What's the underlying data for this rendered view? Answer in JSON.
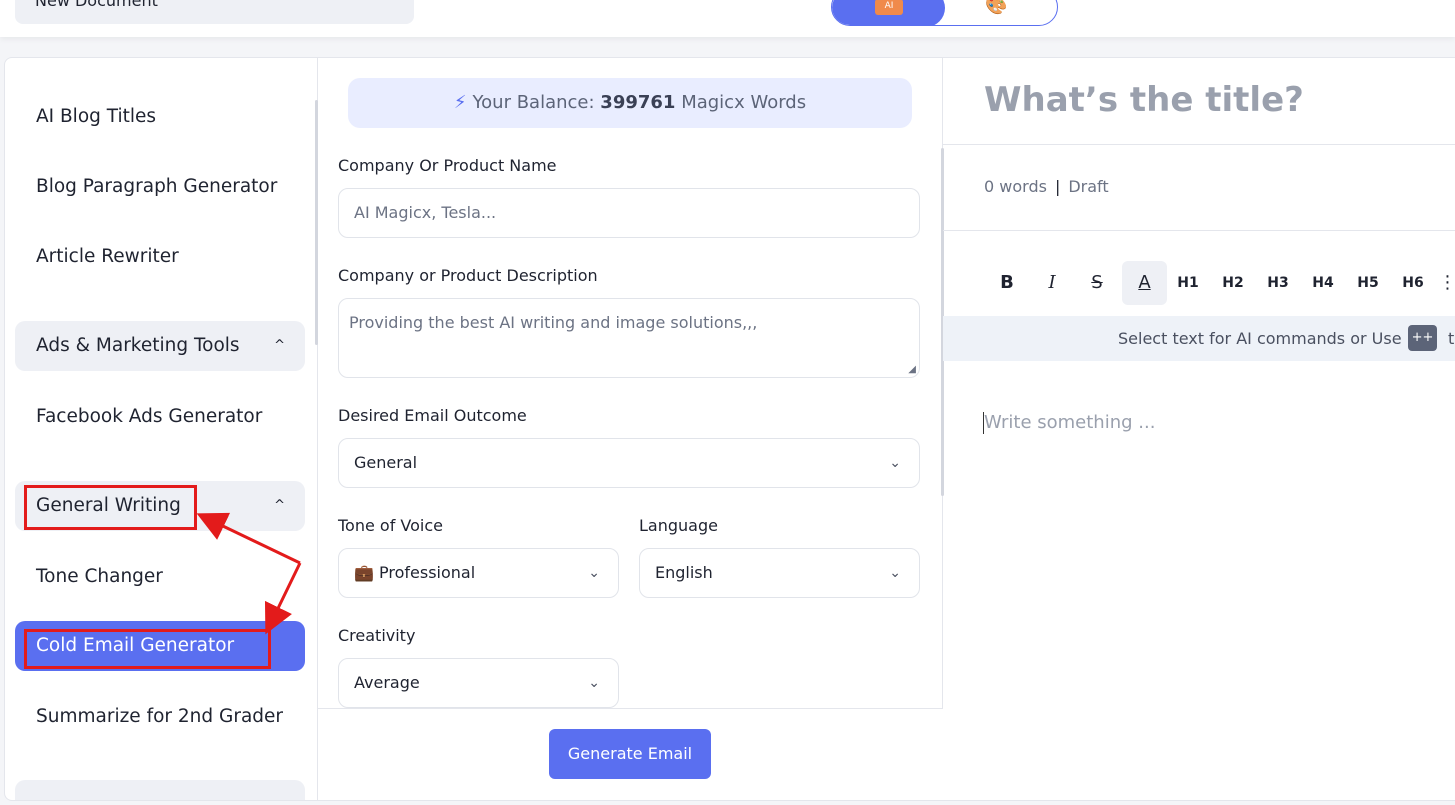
{
  "topbar": {
    "document_name": "New Document",
    "mode_toggle": {
      "ai_icon": "ai-writer-icon",
      "ai_icon_text": "AI",
      "image_icon": "image-generator-icon",
      "image_icon_glyph": "🎨"
    }
  },
  "sidebar": {
    "items": [
      {
        "label": "AI Blog Titles"
      },
      {
        "label": "Blog Paragraph Generator"
      },
      {
        "label": "Article Rewriter"
      }
    ],
    "group_ads": {
      "label": "Ads & Marketing Tools",
      "chevron": "^"
    },
    "ads_items": [
      {
        "label": "Facebook Ads Generator"
      }
    ],
    "group_general": {
      "label": "General Writing",
      "chevron": "^"
    },
    "general_items": [
      {
        "label": "Tone Changer"
      },
      {
        "label": "Cold Email Generator",
        "active": true
      },
      {
        "label": "Summarize for 2nd Grader"
      }
    ]
  },
  "form": {
    "balance": {
      "prefix": "Your Balance:",
      "amount": "399761",
      "suffix": "Magicx Words",
      "icon": "lightning-icon"
    },
    "company_name": {
      "label": "Company Or Product Name",
      "placeholder": "AI Magicx, Tesla..."
    },
    "description": {
      "label": "Company or Product Description",
      "placeholder": "Providing the best AI writing and image solutions,,,"
    },
    "outcome": {
      "label": "Desired Email Outcome",
      "value": "General"
    },
    "tone": {
      "label": "Tone of Voice",
      "emoji": "💼",
      "value": "Professional"
    },
    "language": {
      "label": "Language",
      "value": "English"
    },
    "creativity": {
      "label": "Creativity",
      "value": "Average"
    },
    "submit_label": "Generate Email"
  },
  "editor": {
    "title_placeholder": "What’s the title?",
    "word_count": "0 words",
    "separator": "|",
    "status": "Draft",
    "toolbar": {
      "bold": "B",
      "italic": "I",
      "strike": "S",
      "color": "A",
      "h1": "H1",
      "h2": "H2",
      "h3": "H3",
      "h4": "H4",
      "h5": "H5",
      "h6": "H6",
      "more": "⋮"
    },
    "hint_text": "Select text for AI commands or Use",
    "hint_key": "++",
    "hint_tail": "t",
    "body_placeholder": "Write something ..."
  },
  "colors": {
    "accent": "#5a6ff0",
    "annotation": "#e31b1b",
    "panel_bg": "#eef0f5"
  }
}
